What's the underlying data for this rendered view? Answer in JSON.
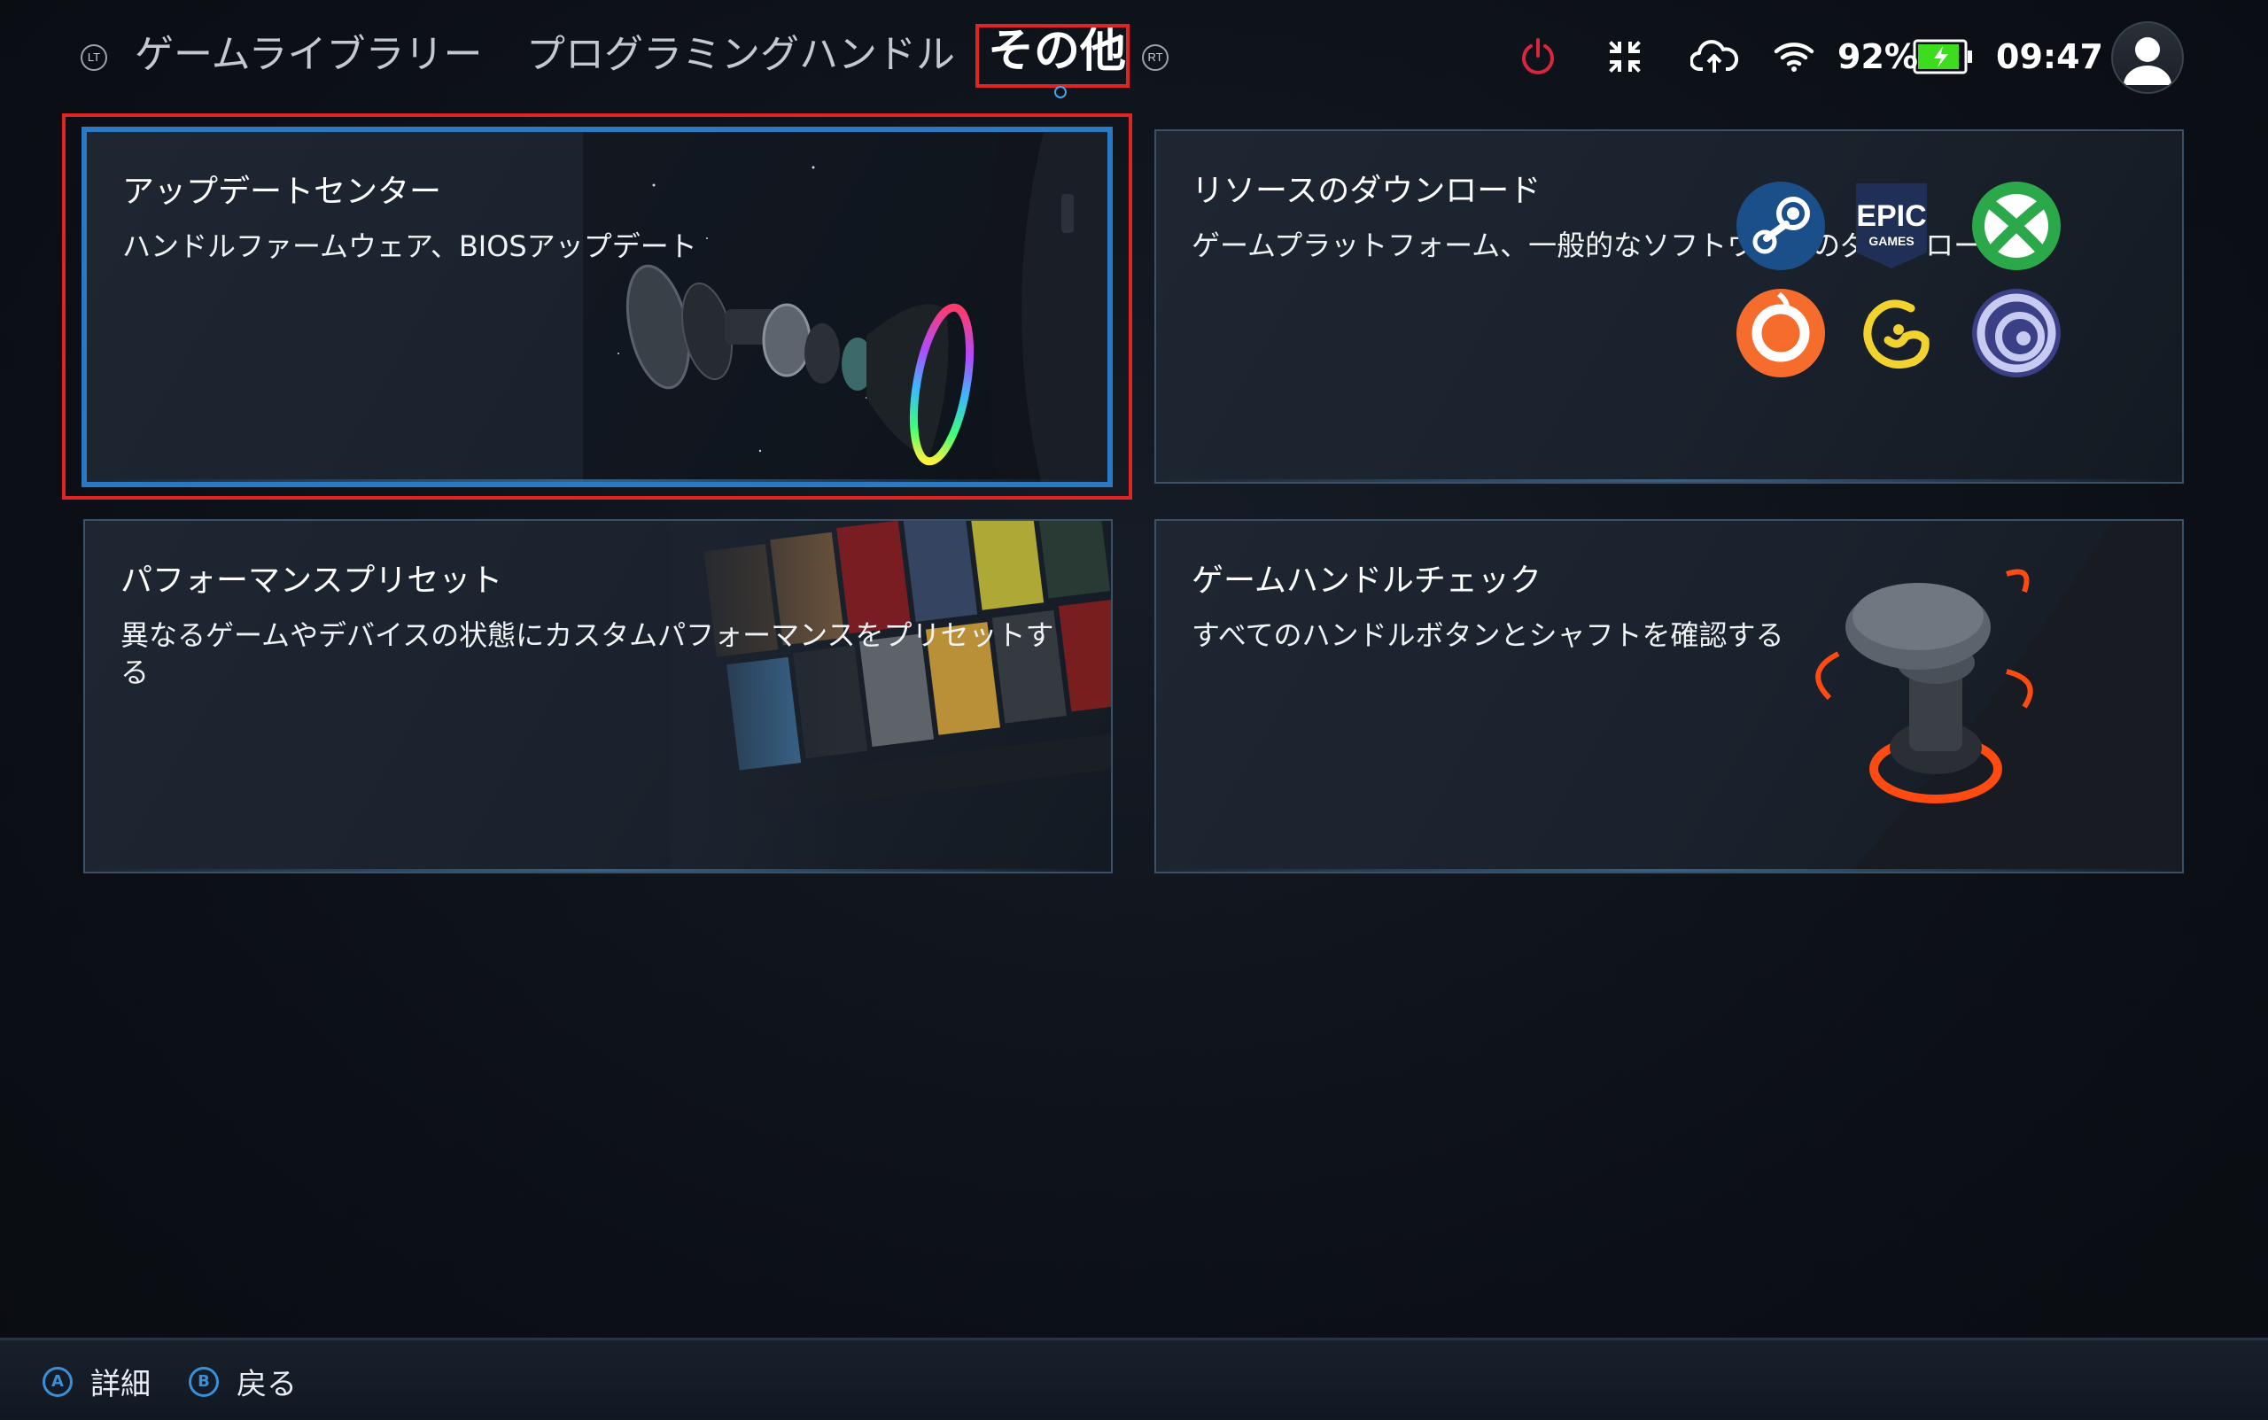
{
  "header": {
    "left_trigger": "LT",
    "right_trigger": "RT",
    "tabs": [
      {
        "label": "ゲームライブラリー",
        "active": false
      },
      {
        "label": "プログラミングハンドル",
        "active": false
      },
      {
        "label": "その他",
        "active": true
      }
    ],
    "status": {
      "icons": [
        "power-icon",
        "fullscreen-exit-icon",
        "cloud-sync-icon",
        "wifi-icon"
      ],
      "battery_percent": "92%",
      "battery_level": 0.92,
      "time": "09:47",
      "accent_power": "#d7263d",
      "battery_color": "#3ddc1f"
    }
  },
  "cards": [
    {
      "id": "update-center",
      "title": "アップデートセンター",
      "description": "ハンドルファームウェア、BIOSアップデート",
      "selected": true
    },
    {
      "id": "resource-download",
      "title": "リソースのダウンロード",
      "description": "ゲームプラットフォーム、一般的なソフトウェアのダウンロード",
      "platforms": [
        {
          "name": "steam",
          "icon": "steam-logo-icon"
        },
        {
          "name": "epic",
          "icon": "epic-games-logo-icon",
          "text_top": "EPIC",
          "text_bottom": "GAMES"
        },
        {
          "name": "xbox",
          "icon": "xbox-logo-icon"
        },
        {
          "name": "origin",
          "icon": "origin-logo-icon"
        },
        {
          "name": "wegame",
          "icon": "wegame-logo-icon"
        },
        {
          "name": "ubisoft",
          "icon": "ubisoft-logo-icon"
        }
      ]
    },
    {
      "id": "performance-preset",
      "title": "パフォーマンスプリセット",
      "description": "異なるゲームやデバイスの状態にカスタムパフォーマンスをプリセットする"
    },
    {
      "id": "gamepad-check",
      "title": "ゲームハンドルチェック",
      "description": "すべてのハンドルボタンとシャフトを確認する"
    }
  ],
  "footer": {
    "hints": [
      {
        "button": "A",
        "label": "詳細"
      },
      {
        "button": "B",
        "label": "戻る"
      }
    ]
  }
}
